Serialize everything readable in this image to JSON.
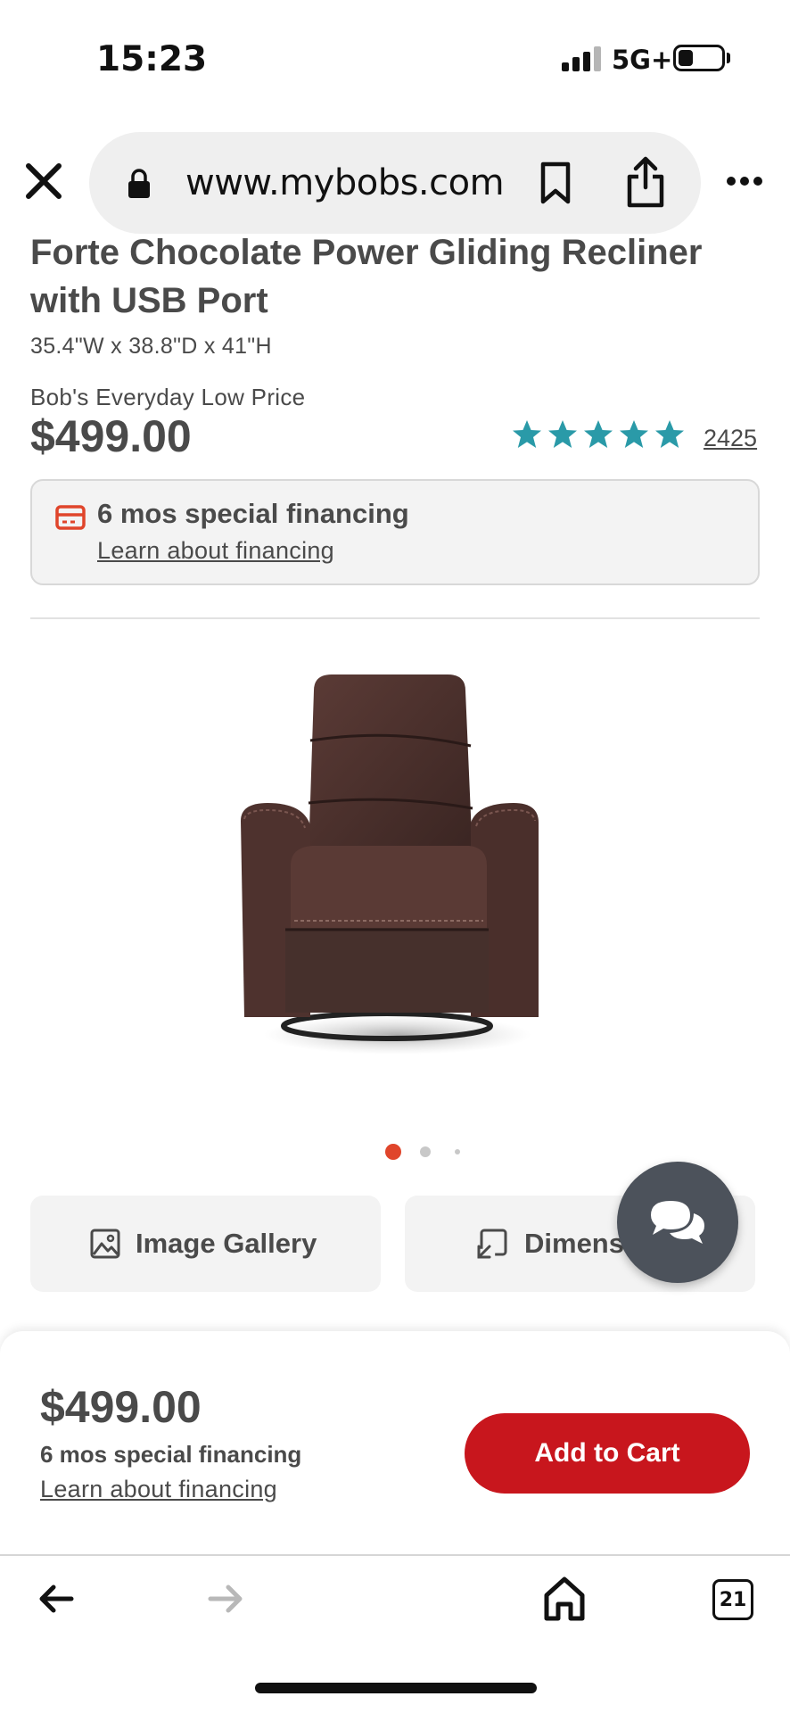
{
  "status_bar": {
    "time": "15:23",
    "network": "5G+"
  },
  "browser": {
    "url": "www.mybobs.com"
  },
  "product": {
    "title": "Forte Chocolate Power Gliding Recliner with USB Port",
    "dimensions": "35.4\"W x 38.8\"D x 41\"H",
    "price_label": "Bob's Everyday Low Price",
    "price": "$499.00",
    "rating_stars": 5,
    "review_count": "2425",
    "star_color": "#2a9aa8"
  },
  "financing": {
    "title": "6 mos special financing",
    "link": "Learn about financing",
    "icon": "credit-card-icon",
    "icon_color": "#e0452b"
  },
  "carousel": {
    "total": 3,
    "active": 0,
    "active_color": "#e0452b"
  },
  "actions": {
    "gallery_label": "Image Gallery",
    "dimensions_label": "Dimensions"
  },
  "sticky_bar": {
    "price": "$499.00",
    "financing": "6 mos special financing",
    "link": "Learn about financing",
    "add_to_cart": "Add to Cart",
    "button_color": "#c8161d"
  },
  "browser_nav": {
    "tabs_count": "21"
  }
}
